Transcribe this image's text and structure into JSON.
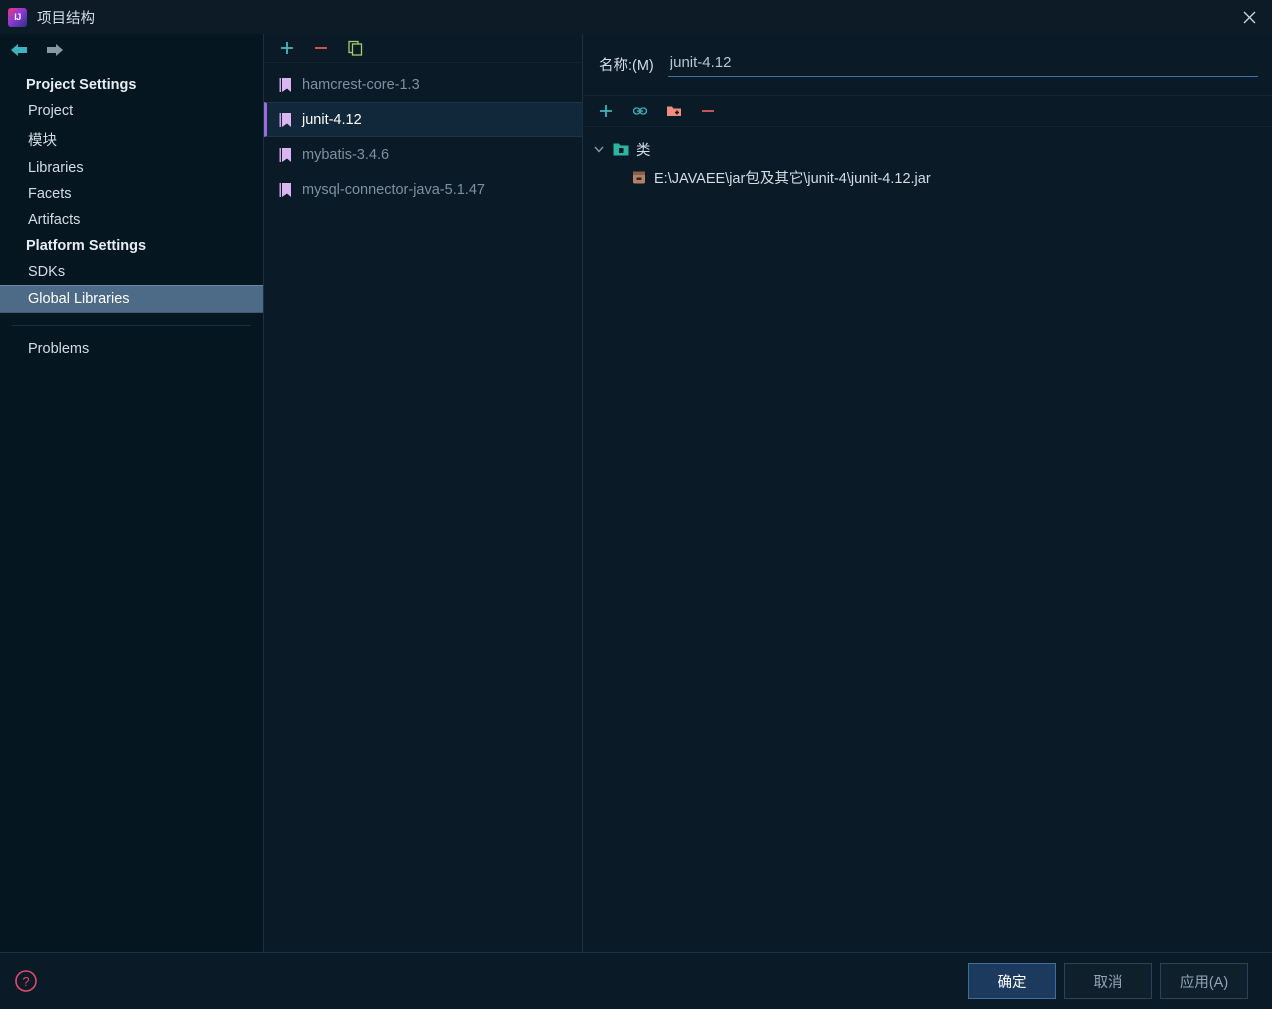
{
  "window": {
    "title": "项目结构",
    "logo_icon": "intellij-idea-logo",
    "close_icon": "close-icon"
  },
  "nav": {
    "back_icon": "back-arrow-icon",
    "forward_icon": "forward-arrow-icon"
  },
  "sidebar": {
    "groups": [
      {
        "label": "Project Settings",
        "items": [
          {
            "label": "Project",
            "selected": false
          },
          {
            "label": "模块",
            "selected": false
          },
          {
            "label": "Libraries",
            "selected": false
          },
          {
            "label": "Facets",
            "selected": false
          },
          {
            "label": "Artifacts",
            "selected": false
          }
        ]
      },
      {
        "label": "Platform Settings",
        "items": [
          {
            "label": "SDKs",
            "selected": false
          },
          {
            "label": "Global Libraries",
            "selected": true
          }
        ]
      }
    ],
    "extra": {
      "label": "Problems"
    }
  },
  "library_panel": {
    "toolbar": [
      {
        "name": "add-library-button",
        "icon": "plus-icon",
        "color": "#4ab8c4"
      },
      {
        "name": "remove-library-button",
        "icon": "minus-icon",
        "color": "#db5c5c"
      },
      {
        "name": "copy-library-button",
        "icon": "copy-icon",
        "color": "#a8cc6a"
      }
    ],
    "items": [
      {
        "label": "hamcrest-core-1.3",
        "selected": false
      },
      {
        "label": "junit-4.12",
        "selected": true
      },
      {
        "label": "mybatis-3.4.6",
        "selected": false
      },
      {
        "label": "mysql-connector-java-5.1.47",
        "selected": false
      }
    ],
    "item_icon": "library-book-icon"
  },
  "details": {
    "name_label": "名称:(M)",
    "name_value": "junit-4.12",
    "name_placeholder": "",
    "roots_toolbar": [
      {
        "name": "add-root-button",
        "icon": "plus-icon",
        "color": "#3fb2bf"
      },
      {
        "name": "attach-url-button",
        "icon": "link-icon",
        "color": "#3fb2bf"
      },
      {
        "name": "add-folder-button",
        "icon": "folder-plus-icon",
        "color": "#ef8d82"
      },
      {
        "name": "remove-root-button",
        "icon": "minus-icon",
        "color": "#db5c5c"
      }
    ],
    "tree": {
      "root": {
        "label": "类",
        "icon": "classes-folder-icon",
        "expanded": true,
        "expand_icon": "chevron-down-icon"
      },
      "children": [
        {
          "label": "E:\\JAVAEE\\jar包及其它\\junit-4\\junit-4.12.jar",
          "icon": "jar-file-icon"
        }
      ]
    }
  },
  "footer": {
    "help_icon": "help-icon",
    "buttons": [
      {
        "label": "确定",
        "name": "ok-button",
        "default": true
      },
      {
        "label": "取消",
        "name": "cancel-button",
        "default": false
      },
      {
        "label": "应用(A)",
        "name": "apply-button",
        "default": false
      }
    ]
  },
  "colors": {
    "background": "#0a1a26",
    "sidebar_background": "#061621",
    "selection_sidebar": "#4d6b87",
    "selection_list": "#11273a",
    "accent_purple": "#9b6ce0",
    "accent_teal": "#3fb2bf",
    "accent_red": "#db5c5c",
    "default_button": "#1c3a5e"
  }
}
